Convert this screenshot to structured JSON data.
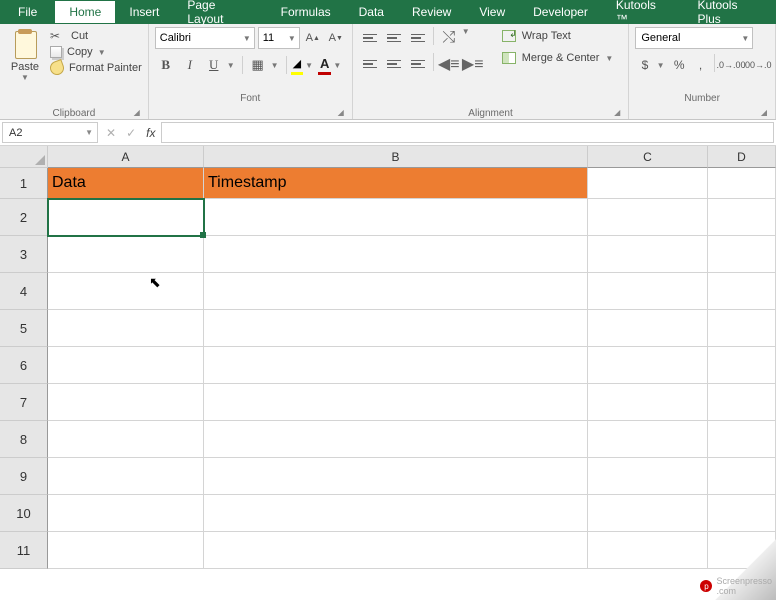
{
  "tabs": {
    "file": "File",
    "home": "Home",
    "insert": "Insert",
    "pageLayout": "Page Layout",
    "formulas": "Formulas",
    "data": "Data",
    "review": "Review",
    "view": "View",
    "developer": "Developer",
    "kutools": "Kutools ™",
    "kutoolsPlus": "Kutools Plus"
  },
  "clipboard": {
    "paste": "Paste",
    "cut": "Cut",
    "copy": "Copy",
    "formatPainter": "Format Painter",
    "groupLabel": "Clipboard"
  },
  "font": {
    "name": "Calibri",
    "size": "11",
    "groupLabel": "Font",
    "bold": "B",
    "italic": "I",
    "underline": "U",
    "increaseA": "A",
    "decreaseA": "A"
  },
  "alignment": {
    "wrapText": "Wrap Text",
    "mergeCenter": "Merge & Center",
    "groupLabel": "Alignment"
  },
  "number": {
    "format": "General",
    "groupLabel": "Number",
    "currency": "$",
    "percent": "%",
    "comma": ","
  },
  "nameBox": "A2",
  "fx": "fx",
  "columns": {
    "A": "A",
    "B": "B",
    "C": "C",
    "D": "D"
  },
  "rowHeaders": [
    "1",
    "2",
    "3",
    "4",
    "5",
    "6",
    "7",
    "8",
    "9",
    "10",
    "11"
  ],
  "cells": {
    "A1": "Data",
    "B1": "Timestamp"
  },
  "watermark": {
    "brand": "Screenpresso",
    "suffix": ".com"
  }
}
